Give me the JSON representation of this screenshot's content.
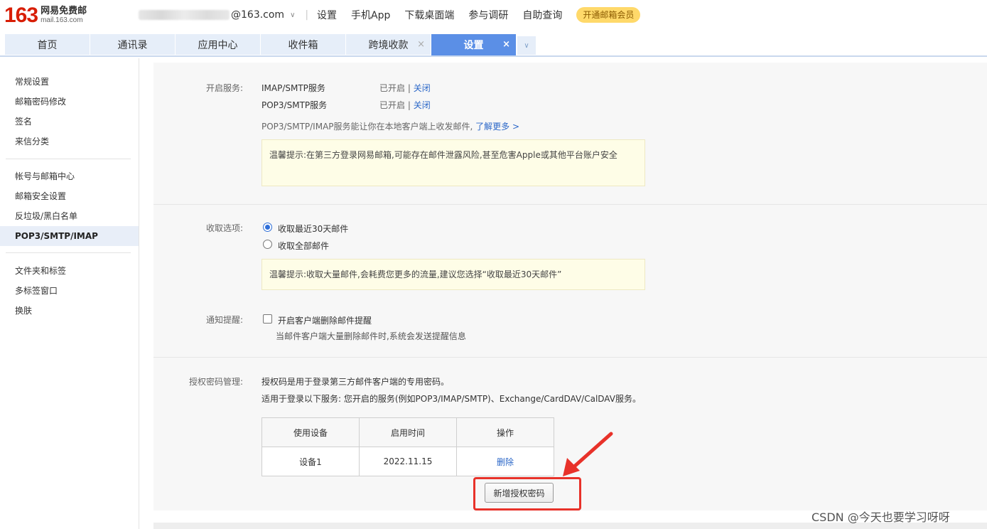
{
  "header": {
    "logo_num": "163",
    "logo_cn": "网易免费邮",
    "logo_en": "mail.163.com",
    "account_suffix": "@163.com",
    "links": [
      "设置",
      "手机App",
      "下载桌面端",
      "参与调研",
      "自助查询"
    ],
    "vip_button": "开通邮箱会员"
  },
  "tabs": [
    {
      "label": "首页",
      "closable": false,
      "active": false
    },
    {
      "label": "通讯录",
      "closable": false,
      "active": false
    },
    {
      "label": "应用中心",
      "closable": false,
      "active": false
    },
    {
      "label": "收件箱",
      "closable": false,
      "active": false
    },
    {
      "label": "跨境收款",
      "closable": true,
      "active": false
    },
    {
      "label": "设置",
      "closable": true,
      "active": true
    }
  ],
  "tab_close_glyph": "×",
  "tab_more_glyph": "∨",
  "sidebar": {
    "items": [
      "常规设置",
      "邮箱密码修改",
      "签名",
      "来信分类",
      "帐号与邮箱中心",
      "邮箱安全设置",
      "反垃圾/黑白名单",
      "POP3/SMTP/IMAP",
      "文件夹和标签",
      "多标签窗口",
      "换肤"
    ],
    "active_index": 7
  },
  "service": {
    "label": "开启服务:",
    "rows": [
      {
        "name": "IMAP/SMTP服务",
        "status": "已开启",
        "action": "关闭"
      },
      {
        "name": "POP3/SMTP服务",
        "status": "已开启",
        "action": "关闭"
      }
    ],
    "status_sep": "|",
    "desc": "POP3/SMTP/IMAP服务能让你在本地客户端上收发邮件,",
    "learn_more": "了解更多 >",
    "tip": "温馨提示:在第三方登录网易邮箱,可能存在邮件泄露风险,甚至危害Apple或其他平台账户安全"
  },
  "fetch": {
    "label": "收取选项:",
    "options": [
      {
        "text": "收取最近30天邮件",
        "checked": true
      },
      {
        "text": "收取全部邮件",
        "checked": false
      }
    ],
    "tip": "温馨提示:收取大量邮件,会耗费您更多的流量,建议您选择“收取最近30天邮件”"
  },
  "notify": {
    "label": "通知提醒:",
    "checkbox_text": "开启客户端删除邮件提醒",
    "checked": false,
    "desc": "当邮件客户端大量删除邮件时,系统会发送提醒信息"
  },
  "auth": {
    "label": "授权密码管理:",
    "line1": "授权码是用于登录第三方邮件客户端的专用密码。",
    "line2": "适用于登录以下服务: 您开启的服务(例如POP3/IMAP/SMTP)、Exchange/CardDAV/CalDAV服务。",
    "table": {
      "headers": [
        "使用设备",
        "启用时间",
        "操作"
      ],
      "rows": [
        [
          "设备1",
          "2022.11.15",
          "删除"
        ]
      ]
    },
    "new_button": "新增授权密码"
  },
  "watermark": "CSDN @今天也要学习呀呀",
  "colors": {
    "brand_red": "#d81e06",
    "active_tab": "#5b8fe6",
    "link": "#2b67c8",
    "annotation": "#e8322a",
    "vip": "#ffd96a"
  }
}
